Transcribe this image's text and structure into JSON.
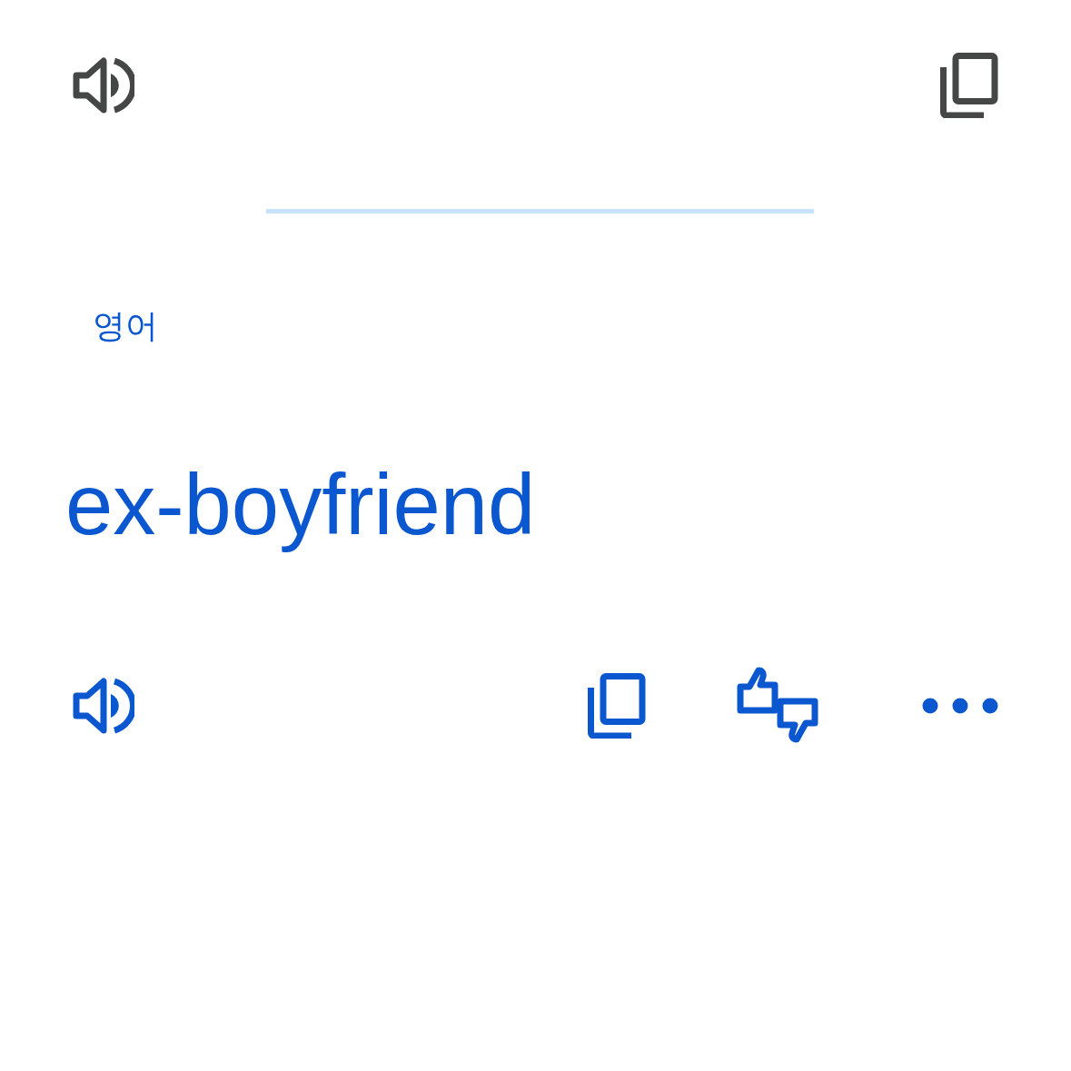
{
  "target": {
    "language": "영어",
    "text": "ex-boyfriend"
  }
}
